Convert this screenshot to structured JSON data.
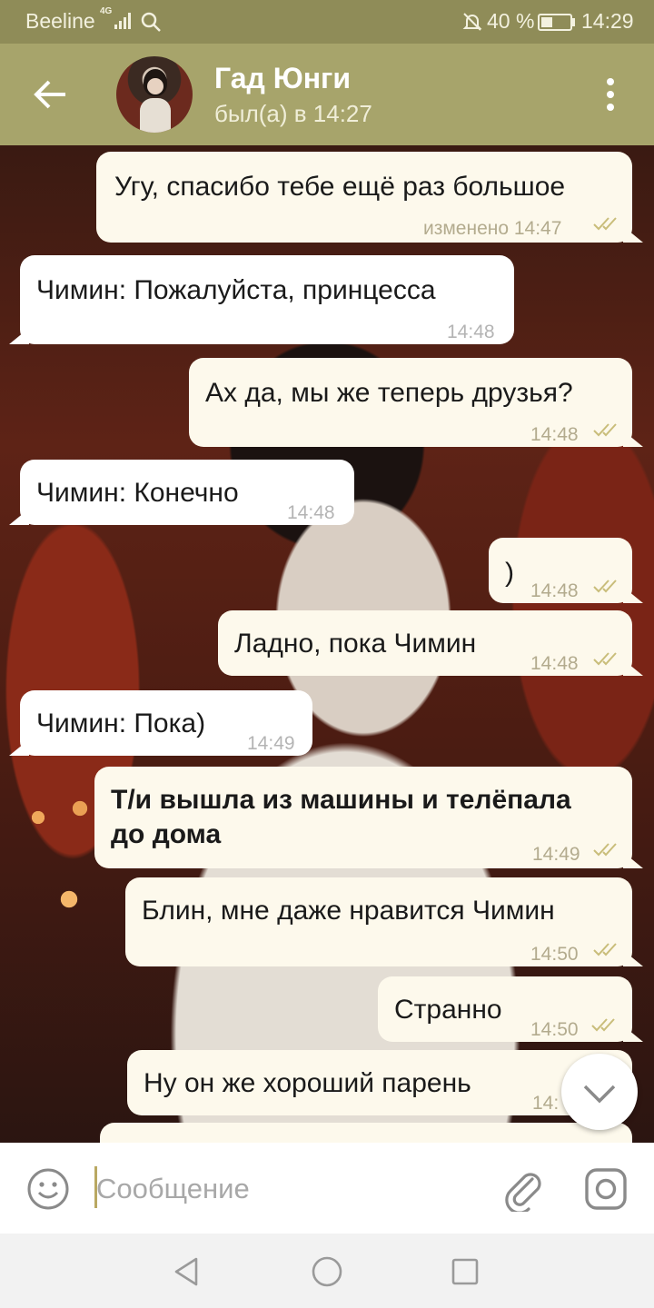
{
  "status_bar": {
    "carrier": "Beeline",
    "network": "4G",
    "battery_percent": "40 %",
    "time": "14:29"
  },
  "header": {
    "contact_name": "Гад Юнги",
    "last_seen": "был(а) в 14:27"
  },
  "messages": [
    {
      "direction": "out",
      "text": "Угу, спасибо тебе ещё раз большое",
      "time": "изменено 14:47",
      "read": true
    },
    {
      "direction": "in",
      "text": "Чимин: Пожалуйста, принцесса",
      "time": "14:48"
    },
    {
      "direction": "out",
      "text": "Ах да, мы же теперь друзья?",
      "time": "14:48",
      "read": true
    },
    {
      "direction": "in",
      "text": "Чимин: Конечно",
      "time": "14:48"
    },
    {
      "direction": "out",
      "text": ")",
      "time": "14:48",
      "read": true
    },
    {
      "direction": "out",
      "text": "Ладно, пока Чимин",
      "time": "14:48",
      "read": true
    },
    {
      "direction": "in",
      "text": "Чимин: Пока)",
      "time": "14:49"
    },
    {
      "direction": "out",
      "text_line1": "Т/и вышла из машины и телёпала",
      "text_line2": "до дома",
      "bold": true,
      "time": "14:49",
      "read": true
    },
    {
      "direction": "out",
      "text": "Блин, мне даже нравится Чимин",
      "time": "14:50",
      "read": true
    },
    {
      "direction": "out",
      "text": "Странно",
      "time": "14:50",
      "read": true
    },
    {
      "direction": "out",
      "text": "Ну он же хороший парень",
      "time": "14:"
    }
  ],
  "composer": {
    "placeholder": "Сообщение"
  },
  "icons": {
    "back": "arrow-left-icon",
    "menu": "more-vertical-icon",
    "emoji": "smile-icon",
    "attach": "paperclip-icon",
    "camera": "camera-icon",
    "scroll": "chevron-down-icon"
  },
  "colors": {
    "header": "#a7a46b",
    "status_bar": "#8f8c58",
    "outgoing_bubble": "#fdf9ec",
    "incoming_bubble": "#ffffff",
    "read_check": "#c9bd7a"
  }
}
